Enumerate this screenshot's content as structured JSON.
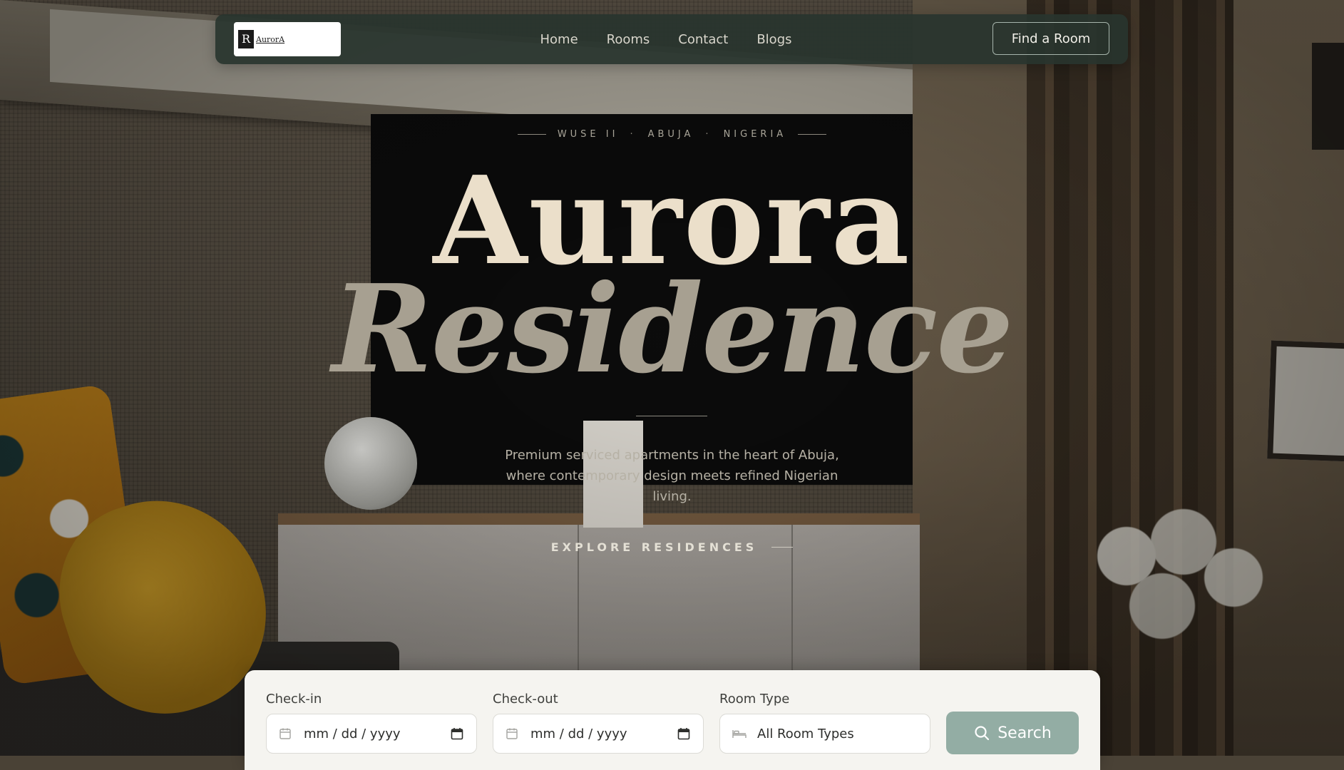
{
  "nav": {
    "logo_text": "AurorA",
    "logo_mark": "R",
    "links": [
      "Home",
      "Rooms",
      "Contact",
      "Blogs"
    ],
    "cta": "Find a Room"
  },
  "hero": {
    "eyebrow": [
      "WUSE II",
      "ABUJA",
      "NIGERIA"
    ],
    "separator": "·",
    "title_line1": "Aurora",
    "title_line2": "Residence",
    "subtitle": "Premium serviced apartments in the heart of Abuja, where contemporary design meets refined Nigerian living.",
    "explore": "EXPLORE RESIDENCES"
  },
  "booking": {
    "checkin_label": "Check-in",
    "checkin_value": "mm / dd / yyyy",
    "checkout_label": "Check-out",
    "checkout_value": "mm / dd / yyyy",
    "room_type_label": "Room Type",
    "room_type_value": "All Room Types",
    "search_label": "Search"
  },
  "colors": {
    "nav_bg": "#28342e",
    "title_light": "#ebdfca",
    "title_muted": "#a7a091",
    "search_btn": "#93ada4",
    "panel_bg": "#f5f4f0"
  },
  "icons": {
    "checkin_lead": "calendar-icon",
    "checkin_trail": "calendar-picker-icon",
    "checkout_lead": "calendar-icon",
    "checkout_trail": "calendar-picker-icon",
    "room_type": "bed-icon",
    "search": "search-icon"
  }
}
